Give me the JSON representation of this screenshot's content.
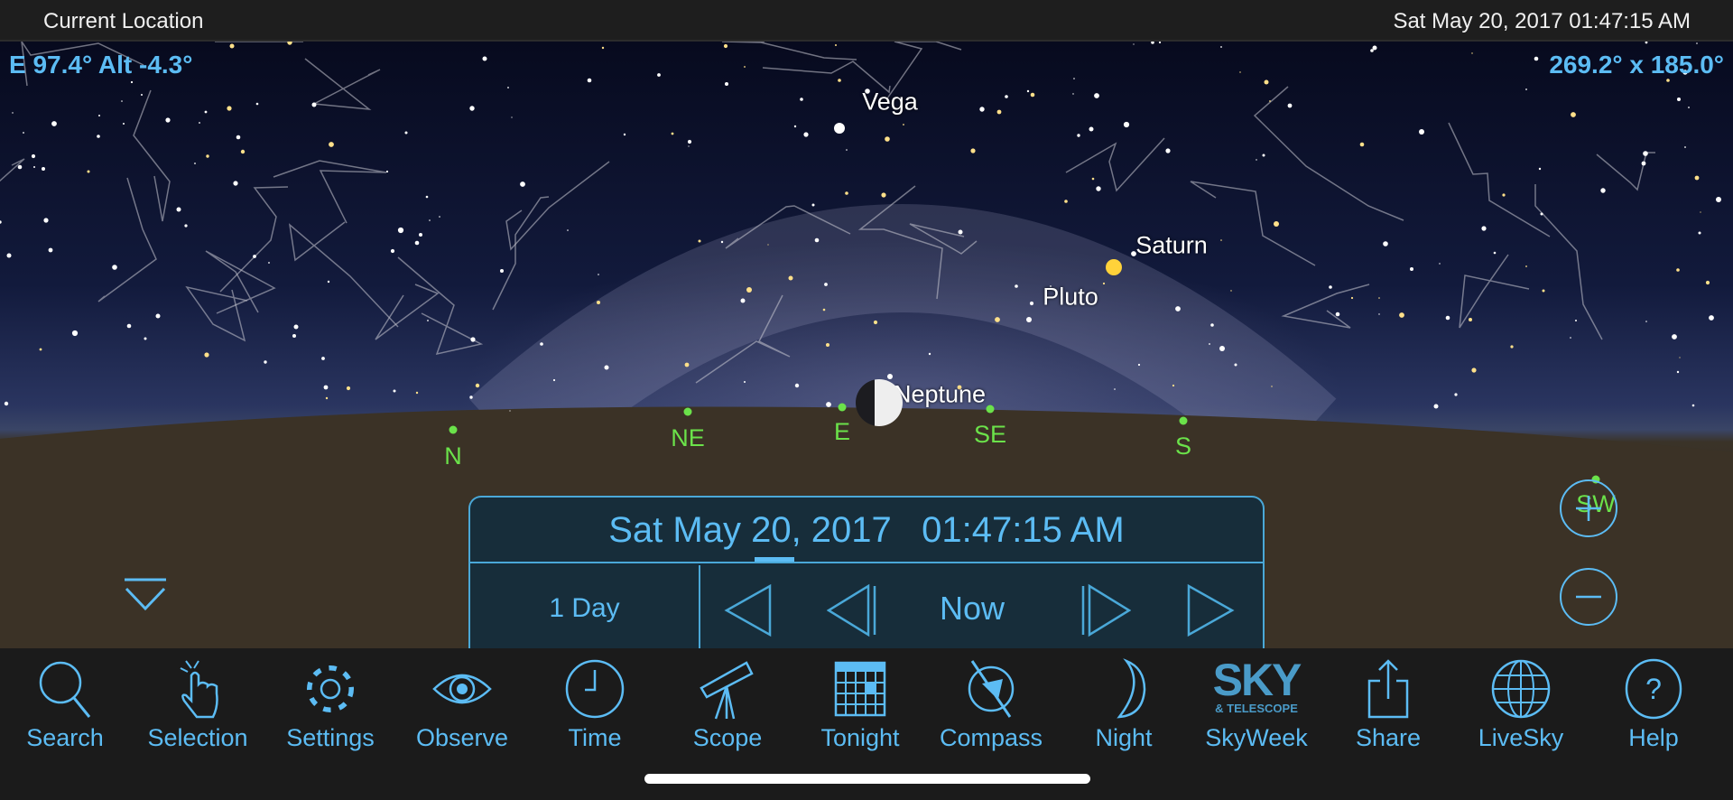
{
  "status_bar": {
    "location": "Current Location",
    "datetime": "Sat May 20, 2017  01:47:15 AM"
  },
  "view": {
    "direction": "E 97.4° Alt -4.3°",
    "field_of_view": "269.2° x 185.0°"
  },
  "sky_labels": [
    "Vega",
    "Saturn",
    "Pluto",
    "Neptune"
  ],
  "compass_points": [
    "N",
    "NE",
    "E",
    "SE",
    "S",
    "SW"
  ],
  "time_panel": {
    "datetime": "Sat May 20, 2017   01:47:15 AM",
    "step": "1 Day",
    "now_label": "Now"
  },
  "toolbar": [
    {
      "label": "Search",
      "icon": "search-icon"
    },
    {
      "label": "Selection",
      "icon": "hand-tap-icon"
    },
    {
      "label": "Settings",
      "icon": "gear-icon"
    },
    {
      "label": "Observe",
      "icon": "eye-icon"
    },
    {
      "label": "Time",
      "icon": "clock-icon"
    },
    {
      "label": "Scope",
      "icon": "telescope-icon"
    },
    {
      "label": "Tonight",
      "icon": "calendar-icon"
    },
    {
      "label": "Compass",
      "icon": "compass-icon"
    },
    {
      "label": "Night",
      "icon": "moon-icon"
    },
    {
      "label": "SkyWeek",
      "icon": "sky-telescope-logo"
    },
    {
      "label": "Share",
      "icon": "share-icon"
    },
    {
      "label": "LiveSky",
      "icon": "globe-icon"
    },
    {
      "label": "Help",
      "icon": "help-icon"
    }
  ],
  "skyweek_logo": {
    "big": "SKY",
    "small": "& TELESCOPE"
  },
  "colors": {
    "accent": "#5cbcf4",
    "compass": "#6be24a"
  }
}
